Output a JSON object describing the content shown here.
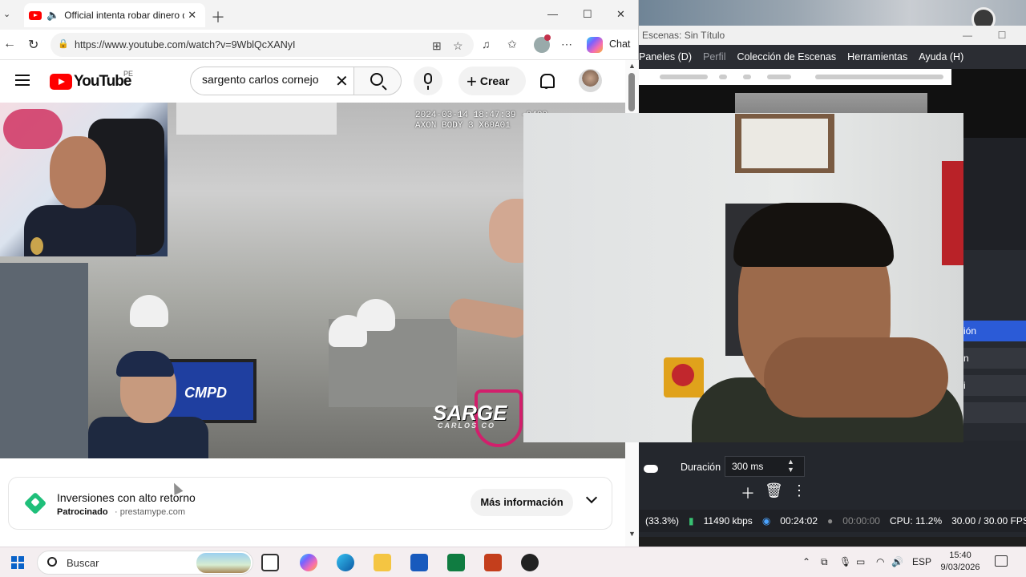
{
  "browser": {
    "tab_title": "Official intenta robar dinero d",
    "url": "https://www.youtube.com/watch?v=9WblQcXANyI",
    "chat_label": "Chat"
  },
  "youtube": {
    "wordmark": "YouTube",
    "country": "PE",
    "search_value": "sargento carlos cornejo",
    "create_label": "Crear"
  },
  "video": {
    "axon_overlay": "2024-03-14 18:47:39 -0400\nAXON BODY 3 X60A01",
    "monitor_text": "CMPD",
    "watermark": "SARGE",
    "watermark_sub": "CARLOS CO"
  },
  "ad": {
    "title": "Inversiones con alto retorno",
    "sponsored": "Patrocinado",
    "domain": "· prestamype.com",
    "more_button": "Más información"
  },
  "obs": {
    "window_title": "Escenas: Sin Título",
    "menu": [
      "Paneles (D)",
      "Perfil",
      "Colección de Escenas",
      "Herramientas",
      "Ayuda (H)"
    ],
    "side_items": [
      "ión",
      "n",
      "i"
    ],
    "duration_label": "Duración",
    "duration_value": "300 ms",
    "status": {
      "dropped": "(33.3%)",
      "bitrate": "11490 kbps",
      "stream_time": "00:24:02",
      "rec_time": "00:00:00",
      "cpu": "CPU: 11.2%",
      "fps": "30.00 / 30.00 FPS"
    }
  },
  "taskbar": {
    "search_label": "Buscar",
    "language": "ESP",
    "time": "15:40",
    "date": "9/03/2026"
  },
  "colors": {
    "youtube_red": "#ff0000",
    "obs_accent": "#2b5bd7",
    "edge_accent": "#0a63c9"
  }
}
